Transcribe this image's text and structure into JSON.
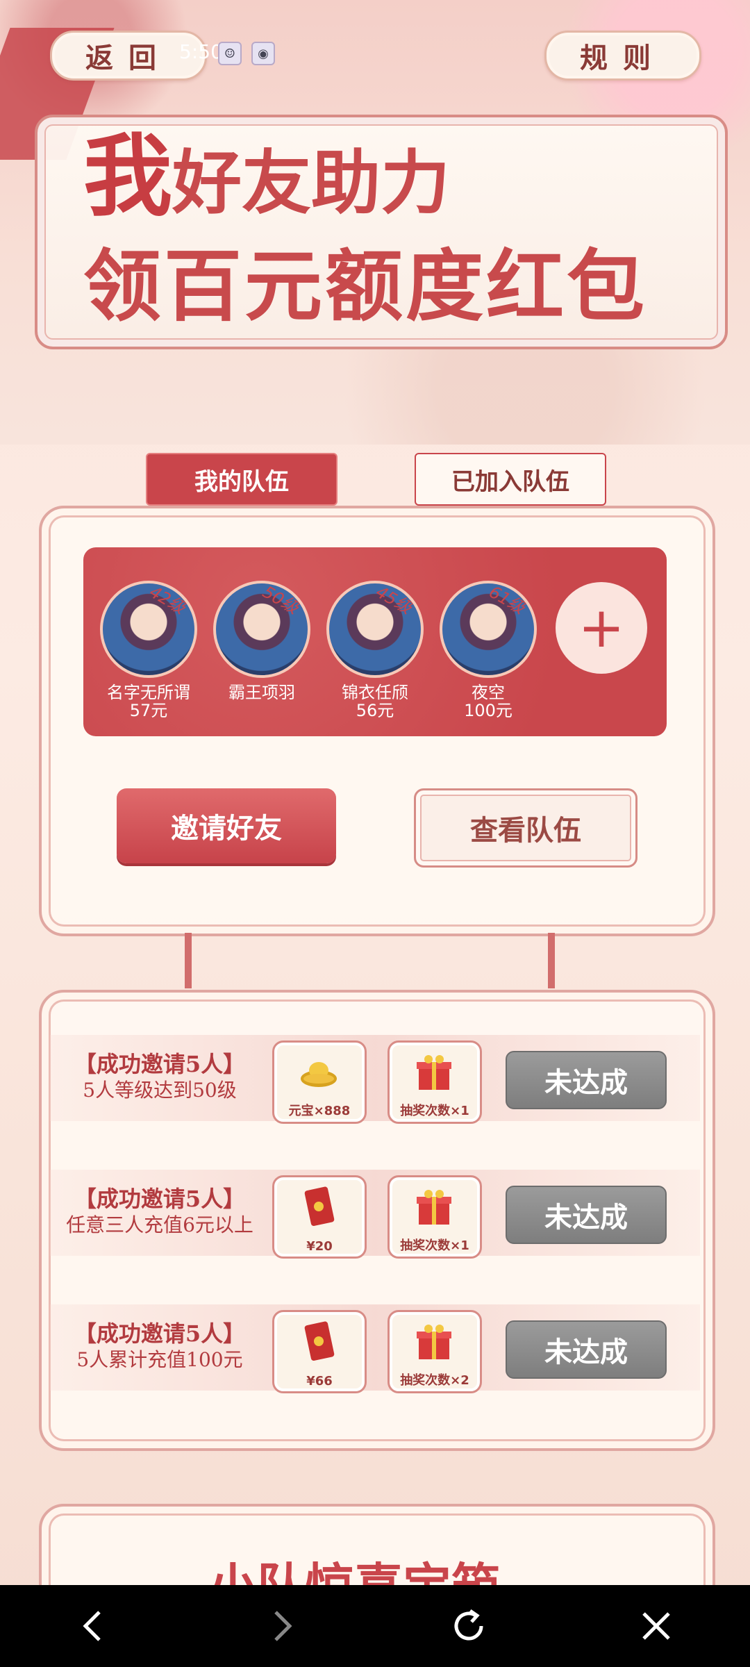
{
  "header": {
    "back_label": "返回",
    "rules_label": "规则",
    "status_time": "5:50"
  },
  "banner": {
    "title_first_char": "我",
    "title_line1_rest": "好友助力",
    "title_line2": "领百元额度红包"
  },
  "tabs": [
    {
      "label": "我的队伍",
      "active": true
    },
    {
      "label": "已加入队伍",
      "active": false
    }
  ],
  "team": {
    "members": [
      {
        "level": "42级",
        "name": "名字无所谓",
        "amount": "57元"
      },
      {
        "level": "50级",
        "name": "霸王项羽",
        "amount": ""
      },
      {
        "level": "45级",
        "name": "锦衣任颀",
        "amount": "56元"
      },
      {
        "level": "61级",
        "name": "夜空",
        "amount": "100元"
      }
    ],
    "add_symbol": "+",
    "invite_label": "邀请好友",
    "view_label": "查看队伍"
  },
  "tasks": [
    {
      "title": "【成功邀请5人】",
      "desc": "5人等级达到50级",
      "reward1": "元宝×888",
      "reward1_icon": "gold-ingot-icon",
      "reward2": "抽奖次数×1",
      "status": "未达成"
    },
    {
      "title": "【成功邀请5人】",
      "desc": "任意三人充值6元以上",
      "reward1": "¥20",
      "reward1_icon": "red-envelope-icon",
      "reward2": "抽奖次数×1",
      "status": "未达成"
    },
    {
      "title": "【成功邀请5人】",
      "desc": "5人累计充值100元",
      "reward1": "¥66",
      "reward1_icon": "red-envelope-icon",
      "reward2": "抽奖次数×2",
      "status": "未达成"
    }
  ],
  "next_section_title": "小队惊喜宝箱",
  "colors": {
    "accent": "#c9454b",
    "background": "#fbe7df",
    "disabled": "#8a8a8a"
  }
}
